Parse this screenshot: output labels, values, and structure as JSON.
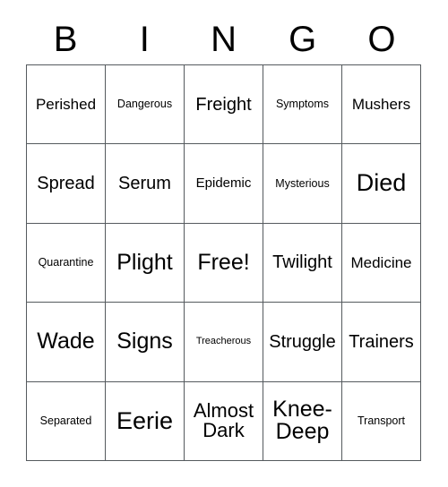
{
  "card": {
    "title": "BINGO",
    "header_letters": [
      "B",
      "I",
      "N",
      "G",
      "O"
    ],
    "rows": [
      [
        {
          "label": "Perished",
          "size": "fs-l"
        },
        {
          "label": "Dangerous",
          "size": "fs-s"
        },
        {
          "label": "Freight",
          "size": "fs-xl"
        },
        {
          "label": "Symptoms",
          "size": "fs-s"
        },
        {
          "label": "Mushers",
          "size": "fs-l"
        }
      ],
      [
        {
          "label": "Spread",
          "size": "fs-xl"
        },
        {
          "label": "Serum",
          "size": "fs-xl"
        },
        {
          "label": "Epidemic",
          "size": "fs-m"
        },
        {
          "label": "Mysterious",
          "size": "fs-s"
        },
        {
          "label": "Died",
          "size": "fs-4xl"
        }
      ],
      [
        {
          "label": "Quarantine",
          "size": "fs-s"
        },
        {
          "label": "Plight",
          "size": "fs-3xl"
        },
        {
          "label": "Free!",
          "size": "fs-3xl"
        },
        {
          "label": "Twilight",
          "size": "fs-xl"
        },
        {
          "label": "Medicine",
          "size": "fs-l"
        }
      ],
      [
        {
          "label": "Wade",
          "size": "fs-3xl"
        },
        {
          "label": "Signs",
          "size": "fs-3xl"
        },
        {
          "label": "Treacherous",
          "size": "fs-xs"
        },
        {
          "label": "Struggle",
          "size": "fs-xl"
        },
        {
          "label": "Trainers",
          "size": "fs-xl"
        }
      ],
      [
        {
          "label": "Separated",
          "size": "fs-s"
        },
        {
          "label": "Eerie",
          "size": "fs-4xl"
        },
        {
          "label": "Almost Dark",
          "size": "fs-2xl"
        },
        {
          "label": "Knee-Deep",
          "size": "fs-3xl"
        },
        {
          "label": "Transport",
          "size": "fs-s"
        }
      ]
    ]
  },
  "colors": {
    "background": "#ffffff",
    "text": "#000000",
    "grid_line": "#555a5e"
  }
}
